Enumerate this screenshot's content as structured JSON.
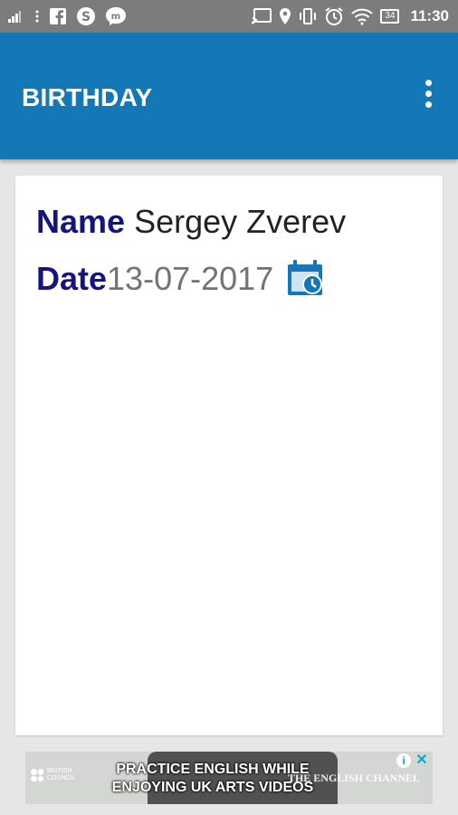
{
  "status_bar": {
    "time": "11:30",
    "battery": "34",
    "icons": [
      "signal-icon",
      "more-vert-icon",
      "facebook-icon",
      "skype-icon",
      "messenger-icon",
      "cast-icon",
      "location-icon",
      "vibrate-icon",
      "alarm-icon",
      "wifi-icon",
      "battery-icon"
    ]
  },
  "app_bar": {
    "title": "BIRTHDAY",
    "menu_icon": "more-vert-icon"
  },
  "card": {
    "name_label": "Name",
    "name_value": "Sergey Zverev",
    "date_label": "Date",
    "date_value": "13-07-2017",
    "date_icon": "calendar-clock-icon"
  },
  "ad": {
    "brand": "BRITISH COUNCIL",
    "line1": "PRACTICE ENGLISH WHILE",
    "line2": "ENJOYING UK ARTS VIDEOS",
    "channel": "THE ENGLISH CHANNEL",
    "info_icon": "info-icon",
    "close_icon": "close-icon"
  },
  "colors": {
    "status_bar": "#7c7c7c",
    "app_bar": "#1378b5",
    "label": "#15147e",
    "date_text": "#737373",
    "background": "#e6e6e6"
  }
}
